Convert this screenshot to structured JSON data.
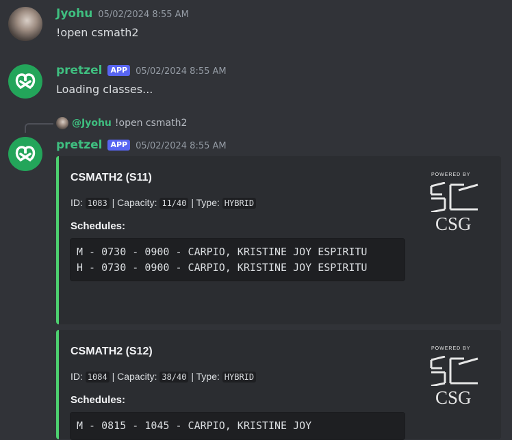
{
  "messages": {
    "m1": {
      "username": "Jyohu",
      "timestamp": "05/02/2024 8:55 AM",
      "content": "!open csmath2"
    },
    "m2": {
      "username": "pretzel",
      "app_tag": "APP",
      "timestamp": "05/02/2024 8:55 AM",
      "content": "Loading classes..."
    },
    "m3": {
      "reply": {
        "mention": "@Jyohu",
        "text": "!open csmath2"
      },
      "username": "pretzel",
      "app_tag": "APP",
      "timestamp": "05/02/2024 8:55 AM"
    }
  },
  "embeds": [
    {
      "title": "CSMATH2 (S11)",
      "id_label": "ID:",
      "id": "1083",
      "capacity_label": "| Capacity:",
      "capacity": "11/40",
      "type_label": "| Type:",
      "type": "HYBRID",
      "schedules_label": "Schedules:",
      "schedules": "M - 0730 - 0900 - CARPIO, KRISTINE JOY ESPIRITU\nH - 0730 - 0900 - CARPIO, KRISTINE JOY ESPIRITU",
      "logo_top": "POWERED BY",
      "logo_text": "CSG"
    },
    {
      "title": "CSMATH2 (S12)",
      "id_label": "ID:",
      "id": "1084",
      "capacity_label": "| Capacity:",
      "capacity": "38/40",
      "type_label": "| Type:",
      "type": "HYBRID",
      "schedules_label": "Schedules:",
      "schedules": "M - 0815 - 1045 - CARPIO, KRISTINE JOY",
      "logo_top": "POWERED BY",
      "logo_text": "CSG"
    }
  ],
  "colors": {
    "embed_border": "#4dd070",
    "bot_avatar": "#23a55a",
    "username_green": "#3fbf80",
    "app_tag": "#5865f2"
  },
  "icons": {
    "bot_avatar": "pretzel-logo-icon"
  }
}
